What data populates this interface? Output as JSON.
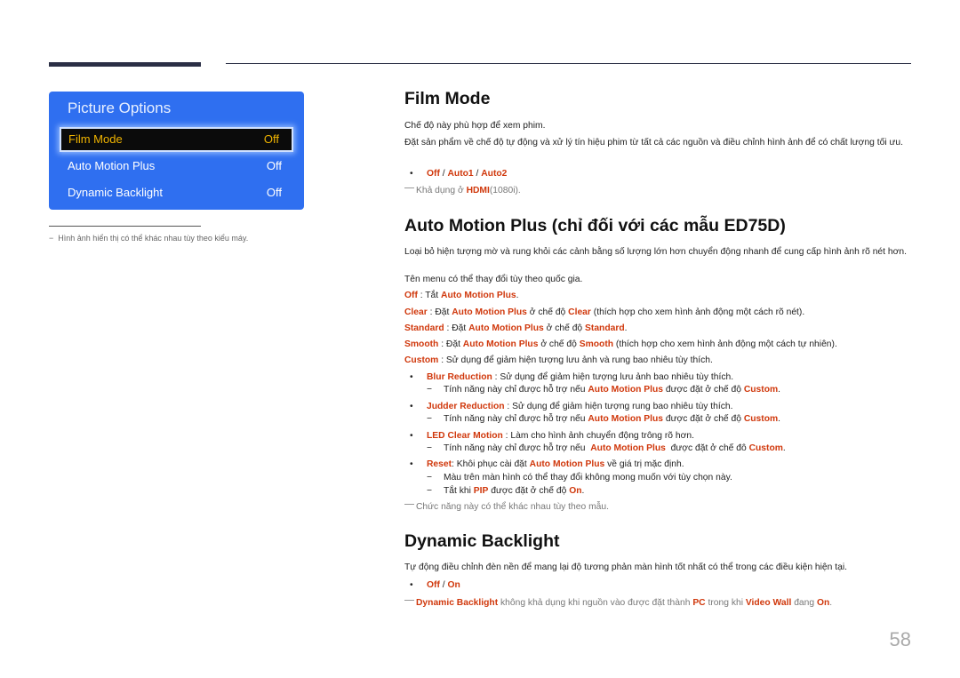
{
  "sidebar": {
    "panel_title": "Picture Options",
    "menu": [
      {
        "label": "Film Mode",
        "value": "Off",
        "selected": true
      },
      {
        "label": "Auto Motion Plus",
        "value": "Off",
        "selected": false
      },
      {
        "label": "Dynamic Backlight",
        "value": "Off",
        "selected": false
      }
    ],
    "note": "Hình ảnh hiển thị có thể khác nhau tùy theo kiểu máy.",
    "note_dash": "−"
  },
  "film_mode": {
    "title": "Film Mode",
    "p1": "Chế độ này phù hợp để xem phim.",
    "p2": "Đặt sản phẩm về chế độ tự động và xử lý tín hiệu phim từ tất cả các nguồn và điều chỉnh hình ảnh để có chất lượng tối ưu.",
    "options": [
      "Off",
      "Auto1",
      "Auto2"
    ],
    "note_prefix": "Khả dụng ở ",
    "note_hl": "HDMI",
    "note_suffix": "(1080i)."
  },
  "amp": {
    "title": "Auto Motion Plus (chỉ đối với các mẫu ED75D)",
    "p1": "Loại bỏ hiện tượng mờ và rung khỏi các cảnh bằng số lượng lớn hơn chuyển động nhanh để cung cấp hình ảnh rõ nét hơn.",
    "p2": "Tên menu có thể thay đổi tùy theo quốc gia.",
    "name": "Auto Motion Plus",
    "off": {
      "key": "Off",
      "text": " : Tắt "
    },
    "clear": {
      "key": "Clear",
      "t1": " : Đặt ",
      "t2": " ở chế độ ",
      "t3": " (thích hợp cho xem hình ảnh động một cách rõ nét)."
    },
    "standard": {
      "key": "Standard",
      "t1": " : Đặt ",
      "t2": " ở chế độ ",
      "t3": "."
    },
    "smooth": {
      "key": "Smooth",
      "t1": " : Đặt ",
      "t2": " ở chế độ ",
      "t3": " (thích hợp cho xem hình ảnh động một cách tự nhiên)."
    },
    "custom": {
      "key": "Custom",
      "text": " : Sử dụng để giảm hiện tượng lưu ảnh và rung bao nhiêu tùy thích."
    },
    "support_prefix": "Tính năng này chỉ được hỗ trợ nếu ",
    "support_mid": " được đặt ở chế độ ",
    "support_mid_alt": " được đặt ở chế đô ",
    "custom_key": "Custom",
    "blur": {
      "key": "Blur Reduction",
      "text": " : Sử dụng để giảm hiện tượng lưu ảnh bao nhiêu tùy thích."
    },
    "judder": {
      "key": "Judder Reduction",
      "text": " : Sử dụng để giảm hiện tượng rung bao nhiêu tùy thích."
    },
    "led": {
      "key": "LED Clear Motion",
      "text": " : Làm cho hình ảnh chuyển động trông rõ hơn."
    },
    "reset": {
      "key": "Reset",
      "t1": ": Khôi phục cài đặt ",
      "t2": " về giá trị mặc định."
    },
    "reset_sub1": "Màu trên màn hình có thể thay đổi không mong muốn với tùy chọn này.",
    "reset_sub2": {
      "t1": "Tắt khi ",
      "pip": "PIP",
      "t2": " được đặt ở chế độ ",
      "on": "On",
      "t3": "."
    },
    "note": "Chức năng này có thể khác nhau tùy theo mẫu."
  },
  "db": {
    "title": "Dynamic Backlight",
    "p1": "Tự động điều chỉnh đèn nền để mang lại độ tương phản màn hình tốt nhất có thể trong các điều kiện hiện tại.",
    "options": [
      "Off",
      "On"
    ],
    "note": {
      "k1": "Dynamic Backlight",
      "t1": " không khả dụng khi nguồn vào được đặt thành ",
      "k2": "PC",
      "t2": " trong khi ",
      "k3": "Video Wall",
      "t3": " đang ",
      "k4": "On",
      "t4": "."
    }
  },
  "sep": " / ",
  "bullet": "•",
  "dash": "−",
  "page_number": "58"
}
